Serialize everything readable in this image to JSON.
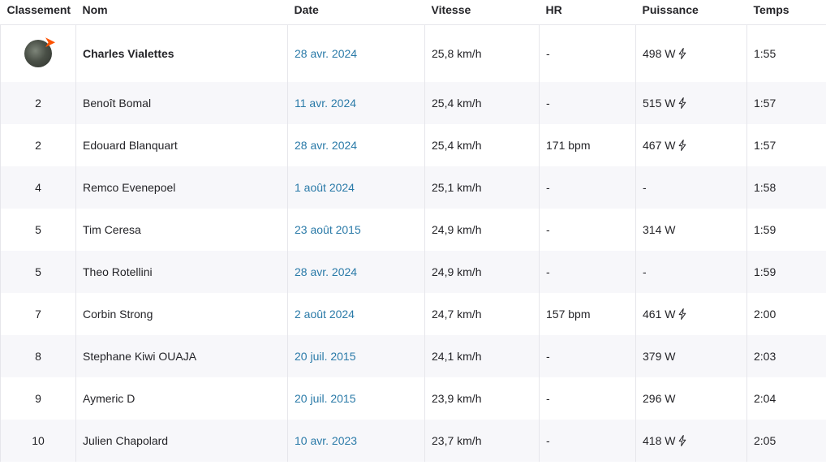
{
  "headers": {
    "rank": "Classement",
    "name": "Nom",
    "date": "Date",
    "speed": "Vitesse",
    "hr": "HR",
    "power": "Puissance",
    "time": "Temps"
  },
  "rows": [
    {
      "rank": "",
      "avatar": "athlete-avatar",
      "name": "Charles Vialettes",
      "date": "28 avr. 2024",
      "speed": "25,8 km/h",
      "hr": "-",
      "power": "498 W",
      "power_icon": "lightning-bolt-icon",
      "time": "1:55"
    },
    {
      "rank": "2",
      "name": "Benoît Bomal",
      "date": "11 avr. 2024",
      "speed": "25,4 km/h",
      "hr": "-",
      "power": "515 W",
      "power_icon": "lightning-bolt-icon",
      "time": "1:57"
    },
    {
      "rank": "2",
      "name": "Edouard Blanquart",
      "date": "28 avr. 2024",
      "speed": "25,4 km/h",
      "hr": "171 bpm",
      "power": "467 W",
      "power_icon": "lightning-bolt-icon",
      "time": "1:57"
    },
    {
      "rank": "4",
      "name": "Remco Evenepoel",
      "date": "1 août 2024",
      "speed": "25,1 km/h",
      "hr": "-",
      "power": "-",
      "time": "1:58"
    },
    {
      "rank": "5",
      "name": "Tim Ceresa",
      "date": "23 août 2015",
      "speed": "24,9 km/h",
      "hr": "-",
      "power": "314 W",
      "time": "1:59"
    },
    {
      "rank": "5",
      "name": "Theo Rotellini",
      "date": "28 avr. 2024",
      "speed": "24,9 km/h",
      "hr": "-",
      "power": "-",
      "time": "1:59"
    },
    {
      "rank": "7",
      "name": "Corbin Strong",
      "date": "2 août 2024",
      "speed": "24,7 km/h",
      "hr": "157 bpm",
      "power": "461 W",
      "power_icon": "lightning-bolt-icon",
      "time": "2:00"
    },
    {
      "rank": "8",
      "name": "Stephane Kiwi OUAJA",
      "date": "20 juil. 2015",
      "speed": "24,1 km/h",
      "hr": "-",
      "power": "379 W",
      "time": "2:03"
    },
    {
      "rank": "9",
      "name": "Aymeric D",
      "date": "20 juil. 2015",
      "speed": "23,9 km/h",
      "hr": "-",
      "power": "296 W",
      "time": "2:04"
    },
    {
      "rank": "10",
      "name": "Julien Chapolard",
      "date": "10 avr. 2023",
      "speed": "23,7 km/h",
      "hr": "-",
      "power": "418 W",
      "power_icon": "lightning-bolt-icon",
      "time": "2:05"
    }
  ],
  "colors": {
    "link": "#2a7aa8",
    "text": "#242428",
    "stripe": "#f7f7fa",
    "brand": "#fc5200"
  }
}
